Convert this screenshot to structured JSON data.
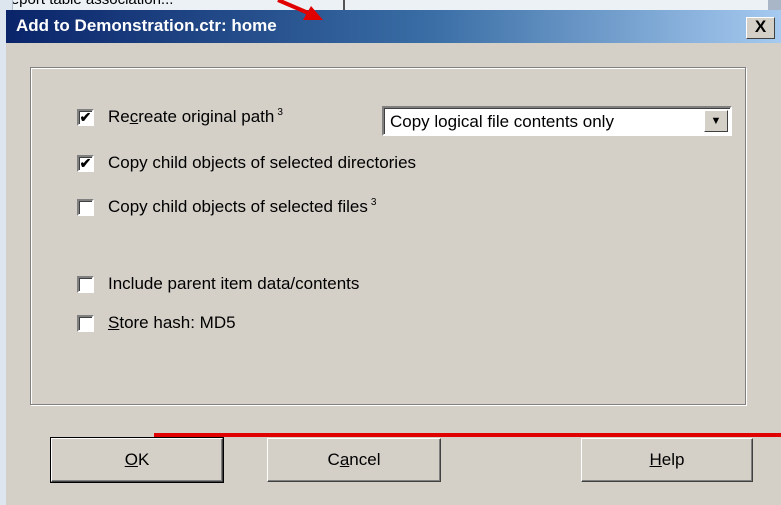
{
  "background": {
    "partial_text": "Report table association..."
  },
  "dialog": {
    "title": "Add to Demonstration.ctr: home",
    "close_glyph": "X",
    "options": {
      "recreate_path": {
        "pre": "Re",
        "accel": "c",
        "post": "reate original path",
        "superscript": "3",
        "checked": true
      },
      "copy_child_dirs": {
        "label": "Copy child objects of selected directories",
        "checked": true
      },
      "copy_child_files": {
        "label": "Copy child objects of selected files",
        "superscript": "3",
        "checked": false
      },
      "include_parent": {
        "label": "Include parent item data/contents",
        "checked": false
      },
      "store_hash": {
        "accel": "S",
        "post": "tore hash: MD5",
        "checked": false
      }
    },
    "copy_mode": {
      "selected": "Copy logical file contents only"
    },
    "buttons": {
      "ok": {
        "accel": "O",
        "post": "K"
      },
      "cancel": {
        "pre": "C",
        "accel": "a",
        "post": "ncel"
      },
      "help": {
        "accel": "H",
        "post": "elp"
      }
    }
  },
  "annotation": {
    "color": "#e10000"
  },
  "check_glyph": "✔"
}
